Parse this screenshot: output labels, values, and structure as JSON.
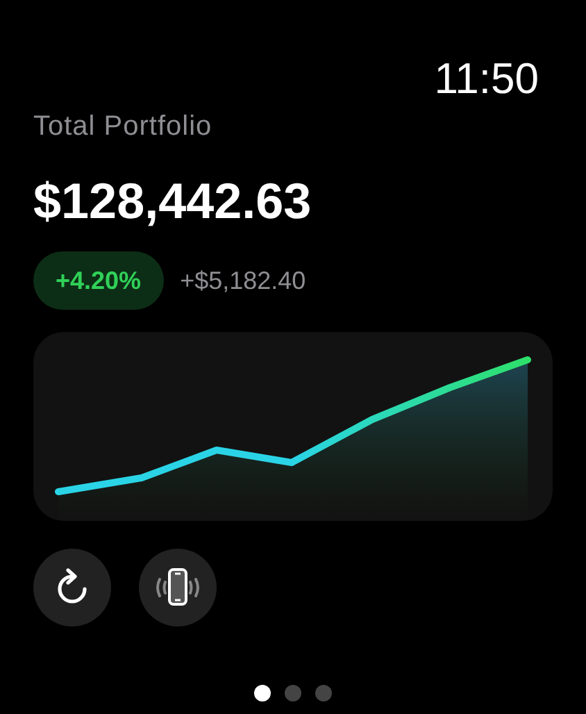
{
  "status_bar": {
    "time": "11:50"
  },
  "title": "Total Portfolio",
  "balance": "$128,442.63",
  "change": {
    "percent": "+4.20%",
    "amount": "+$5,182.40",
    "positive": true
  },
  "actions": [
    {
      "kind": "refresh"
    },
    {
      "kind": "phone"
    }
  ],
  "pages": [
    {
      "selected": true
    },
    {
      "selected": false
    },
    {
      "selected": false
    }
  ]
}
